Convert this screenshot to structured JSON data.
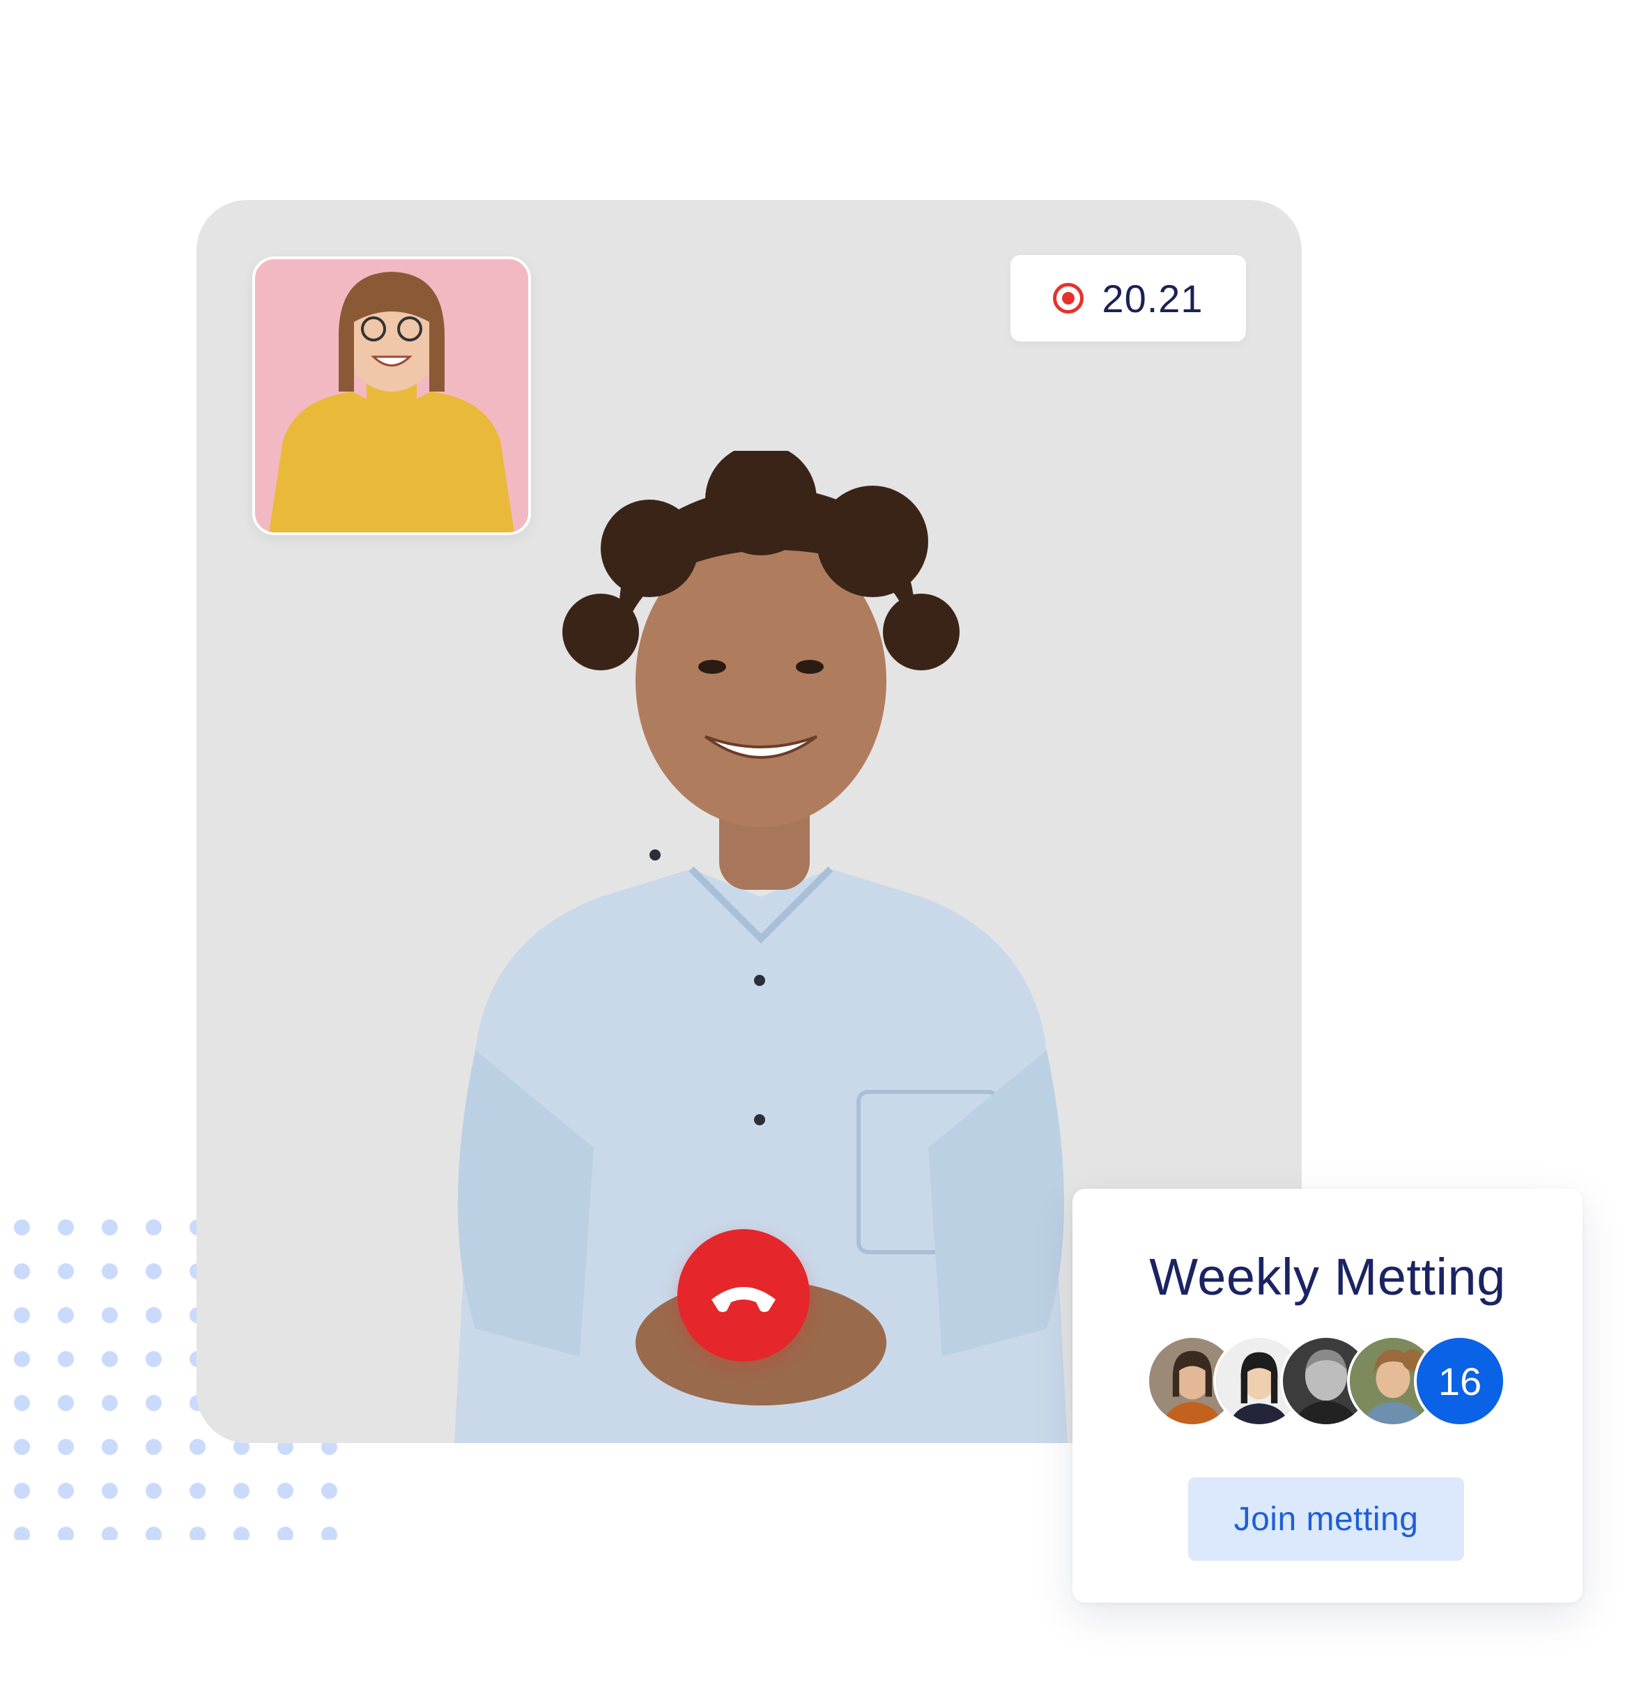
{
  "call": {
    "recording_time": "20.21",
    "recording_icon": "record-icon",
    "end_call_icon": "phone-hangup-icon"
  },
  "meeting_card": {
    "title": "Weekly Metting",
    "participant_count": "16",
    "join_label": "Join metting"
  },
  "colors": {
    "stage_bg": "#e4e4e4",
    "record_red": "#e5322d",
    "end_call_red": "#e5262b",
    "title_navy": "#1a2463",
    "count_blue": "#0a62e6",
    "join_bg": "#dce8fb",
    "join_text": "#1d5fd6",
    "self_view_bg": "#f3b9c2"
  }
}
